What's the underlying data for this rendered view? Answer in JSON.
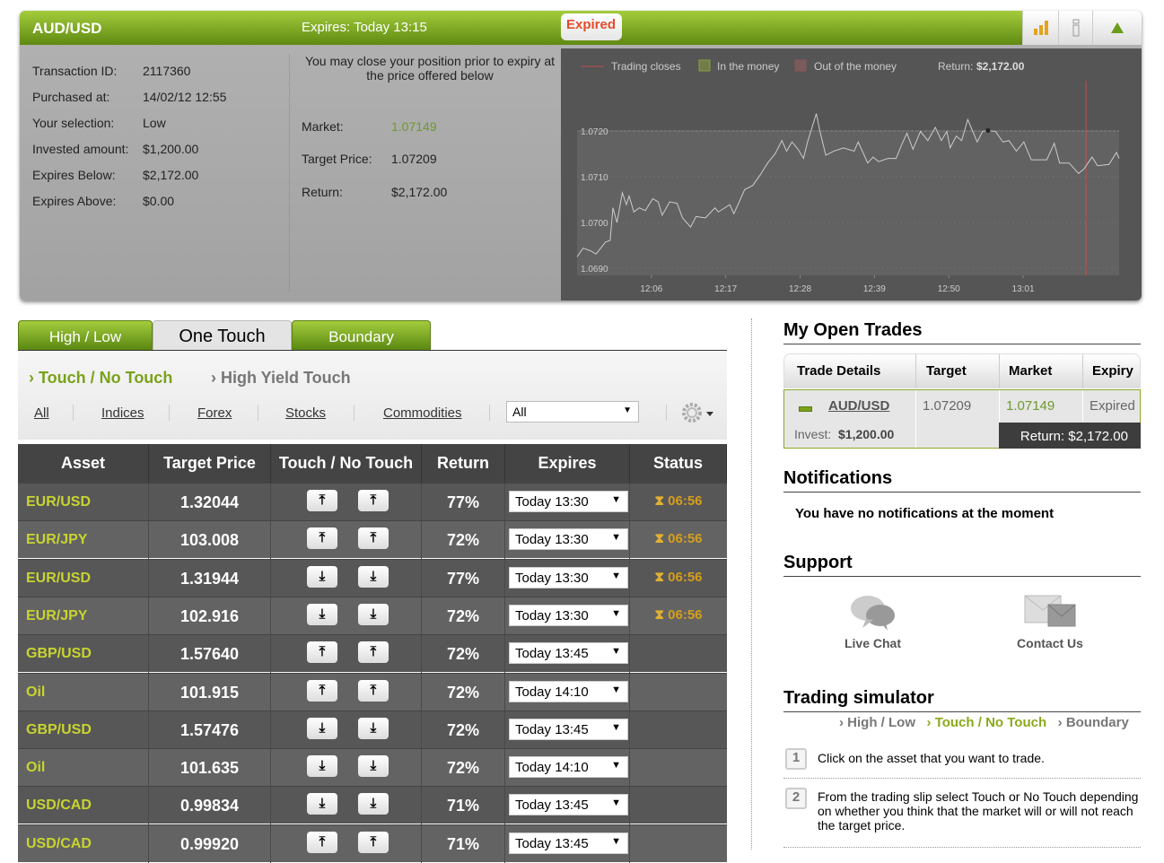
{
  "trade_panel": {
    "symbol": "AUD/USD",
    "expires_label": "Expires:  Today 13:15",
    "status_badge": "Expired",
    "details": [
      {
        "label": "Transaction ID:",
        "value": "2117360"
      },
      {
        "label": "Purchased at:",
        "value": "14/02/12 12:55"
      },
      {
        "label": "Your selection:",
        "value": "Low"
      },
      {
        "label": "Invested amount:",
        "value": "$1,200.00"
      },
      {
        "label": "Expires Below:",
        "value": "$2,172.00"
      },
      {
        "label": "Expires Above:",
        "value": "$0.00"
      }
    ],
    "close_note": "You may close your position prior to expiry at the price offered below",
    "market_label": "Market:",
    "market_value": "1.07149",
    "target_label": "Target Price:",
    "target_value": "1.07209",
    "return_label": "Return:",
    "return_value": "$2,172.00",
    "colors": {
      "accent": "#7fae1f",
      "market": "#6e9a2e",
      "expired": "#e54b2a"
    }
  },
  "chart_data": {
    "type": "line",
    "legend": [
      "Trading closes",
      "In the money",
      "Out of the money"
    ],
    "return_text": "Return:",
    "return_value": "$2,172.00",
    "ylim": [
      1.069,
      1.072
    ],
    "yticks": [
      "1.0720",
      "1.0710",
      "1.0700",
      "1.0690"
    ],
    "xlim": [
      0,
      80.2
    ],
    "xtick_minutes": [
      11,
      22,
      33,
      44,
      55,
      66
    ],
    "xticks": [
      "12:06",
      "12:17",
      "12:28",
      "12:39",
      "12:50",
      "13:01"
    ],
    "trading_closes_minute": 75.3,
    "entry_point": [
      60.8,
      1.07201
    ],
    "x": [
      0,
      0.9,
      2,
      2.8,
      4.2,
      4.9,
      5.3,
      5.9,
      6.7,
      7.3,
      7.7,
      8.4,
      9.2,
      10.1,
      11.2,
      12,
      12.6,
      13.7,
      14.8,
      15.6,
      16.8,
      17.6,
      19,
      20.4,
      20.9,
      22.6,
      23.2,
      24.8,
      26,
      27.1,
      28.2,
      29.3,
      30.3,
      31,
      31.8,
      32.7,
      33.5,
      34.1,
      35.4,
      36,
      36.8,
      38,
      39.4,
      41,
      41.6,
      43,
      43.8,
      44.6,
      46,
      47.2,
      48,
      48.8,
      49.7,
      50.8,
      51.9,
      53,
      53.9,
      54.7,
      55.2,
      56.1,
      56.9,
      57.8,
      59.2,
      60,
      60.8,
      61.9,
      63,
      63.9,
      65,
      66.1,
      67.2,
      69.5,
      70.6,
      71.4,
      72.8,
      74.2,
      75,
      76.2,
      77,
      78.7,
      79.8,
      80.2
    ],
    "y": [
      1.06925,
      1.06944,
      1.06938,
      1.06931,
      1.06957,
      1.06961,
      1.07032,
      1.07,
      1.07065,
      1.07039,
      1.07058,
      1.07023,
      1.07032,
      1.07026,
      1.07052,
      1.07045,
      1.07016,
      1.07045,
      1.07042,
      1.0701,
      1.0699,
      1.07013,
      1.0701,
      1.07032,
      1.07023,
      1.07039,
      1.07019,
      1.07072,
      1.07081,
      1.07104,
      1.0713,
      1.0715,
      1.07179,
      1.07156,
      1.07176,
      1.0716,
      1.0714,
      1.07176,
      1.07238,
      1.07195,
      1.07147,
      1.07156,
      1.07163,
      1.07156,
      1.07176,
      1.0713,
      1.07143,
      1.07133,
      1.0714,
      1.0714,
      1.07169,
      1.07195,
      1.0716,
      1.07199,
      1.07179,
      1.07208,
      1.07179,
      1.07199,
      1.07163,
      1.07189,
      1.07179,
      1.07225,
      1.07176,
      1.07199,
      1.07201,
      1.07199,
      1.07176,
      1.07179,
      1.07156,
      1.07176,
      1.07137,
      1.07137,
      1.07173,
      1.0713,
      1.0713,
      1.07107,
      1.07117,
      1.07143,
      1.07124,
      1.07127,
      1.07153,
      1.0714
    ]
  },
  "tabs": [
    "High / Low",
    "One Touch",
    "Boundary"
  ],
  "subtabs": [
    "Touch / No Touch",
    "High Yield Touch"
  ],
  "categories": [
    "All",
    "Indices",
    "Forex",
    "Stocks",
    "Commodities"
  ],
  "market_select": "All",
  "table": {
    "headers": [
      "Asset",
      "Target Price",
      "Touch / No Touch",
      "Return",
      "Expires",
      "Status"
    ],
    "rows": [
      {
        "asset": "EUR/USD",
        "target": "1.32044",
        "dir": "up",
        "ret": "77%",
        "expires": "Today 13:30",
        "status": "06:56"
      },
      {
        "asset": "EUR/JPY",
        "target": "103.008",
        "dir": "up",
        "ret": "72%",
        "expires": "Today 13:30",
        "status": "06:56"
      },
      {
        "asset": "EUR/USD",
        "target": "1.31944",
        "dir": "down",
        "ret": "77%",
        "expires": "Today 13:30",
        "status": "06:56"
      },
      {
        "asset": "EUR/JPY",
        "target": "102.916",
        "dir": "down",
        "ret": "72%",
        "expires": "Today 13:30",
        "status": "06:56"
      },
      {
        "asset": "GBP/USD",
        "target": "1.57640",
        "dir": "up",
        "ret": "72%",
        "expires": "Today 13:45",
        "status": ""
      },
      {
        "asset": "Oil",
        "target": "101.915",
        "dir": "up",
        "ret": "72%",
        "expires": "Today 14:10",
        "status": ""
      },
      {
        "asset": "GBP/USD",
        "target": "1.57476",
        "dir": "down",
        "ret": "72%",
        "expires": "Today 13:45",
        "status": ""
      },
      {
        "asset": "Oil",
        "target": "101.635",
        "dir": "down",
        "ret": "72%",
        "expires": "Today 14:10",
        "status": ""
      },
      {
        "asset": "USD/CAD",
        "target": "0.99834",
        "dir": "down",
        "ret": "71%",
        "expires": "Today 13:45",
        "status": ""
      },
      {
        "asset": "USD/CAD",
        "target": "0.99920",
        "dir": "up",
        "ret": "71%",
        "expires": "Today 13:45",
        "status": ""
      }
    ]
  },
  "open_trades": {
    "title": "My Open Trades",
    "headers": [
      "Trade Details",
      "Target",
      "Market",
      "Expiry"
    ],
    "asset": "AUD/USD",
    "target": "1.07209",
    "market": "1.07149",
    "expiry": "Expired",
    "invest_label": "Invest:",
    "invest_value": "$1,200.00",
    "return": "Return: $2,172.00"
  },
  "notifications": {
    "title": "Notifications",
    "message": "You have no notifications at the moment"
  },
  "support": {
    "title": "Support",
    "live_chat": "Live Chat",
    "contact_us": "Contact Us"
  },
  "simulator": {
    "title": "Trading simulator",
    "nav": [
      "High / Low",
      "Touch / No Touch",
      "Boundary"
    ],
    "steps": [
      {
        "n": "1",
        "text": "Click on the asset that you want to trade."
      },
      {
        "n": "2",
        "text": "From the trading slip select Touch or  No Touch depending on whether you think that the market will or will not reach the target price."
      }
    ]
  }
}
